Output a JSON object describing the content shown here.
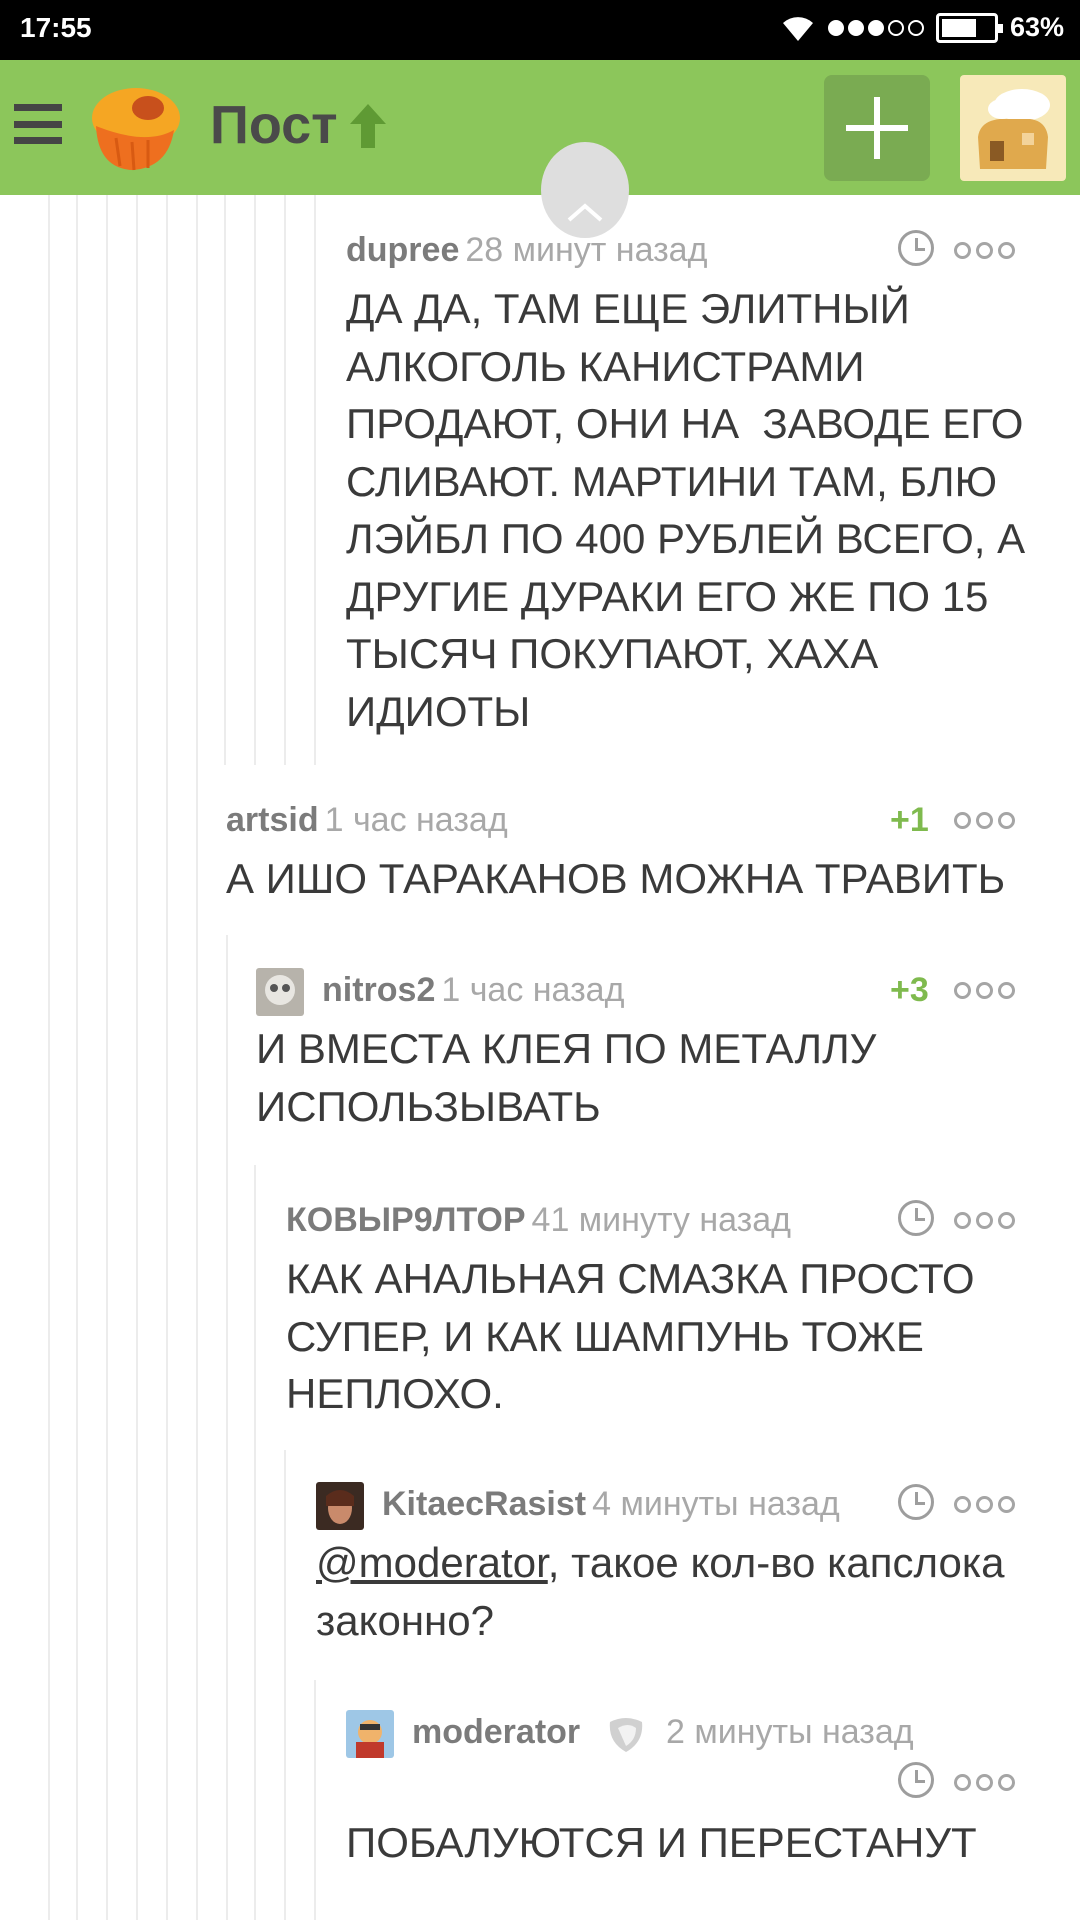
{
  "status": {
    "time": "17:55",
    "battery": "63%"
  },
  "header": {
    "title": "Пост"
  },
  "comments": [
    {
      "author": "dupree",
      "time": "28 минут назад",
      "rating": "",
      "text": [
        "ДА ДА, ТАМ ЕЩЕ ЭЛИТНЫЙ",
        "АЛКОГОЛЬ КАНИСТРАМИ",
        "ПРОДАЮТ, ОНИ НА  ЗАВОДЕ ЕГО",
        "СЛИВАЮТ. МАРТИНИ ТАМ, БЛЮ",
        "ЛЭЙБЛ ПО 400 РУБЛЕЙ ВСЕГО, А",
        "ДРУГИЕ ДУРАКИ ЕГО ЖЕ ПО 15",
        "ТЫСЯЧ ПОКУПАЮТ, ХАХА",
        "ИДИОТЫ"
      ]
    },
    {
      "author": "artsid",
      "time": "1 час назад",
      "rating": "+1",
      "text": [
        "А ИШО ТАРАКАНОВ МОЖНА ТРАВИТЬ"
      ]
    },
    {
      "author": "nitros2",
      "time": "1 час назад",
      "rating": "+3",
      "text": [
        "И ВМЕСТА КЛЕЯ ПО МЕТАЛЛУ",
        "ИСПОЛЬЗЫВАТЬ"
      ]
    },
    {
      "author": "КОВЫР9ЛТОР",
      "time": "41 минуту назад",
      "rating": "",
      "text": [
        "КАК АНАЛЬНАЯ СМАЗКА ПРОСТО",
        "СУПЕР, И КАК ШАМПУНЬ ТОЖЕ",
        "НЕПЛОХО."
      ]
    },
    {
      "author": "KitaecRasist",
      "time": "4 минуты назад",
      "rating": "",
      "mention": "@moderator",
      "text_after_mention": ", такое кол-во капслока",
      "text2": "законно?"
    },
    {
      "author": "moderator",
      "time": "2 минуты назад",
      "rating": "",
      "text": [
        "ПОБАЛУЮТСЯ И ПЕРЕСТАНУТ"
      ]
    }
  ],
  "icons": {
    "menu": "menu-icon",
    "logo": "cupcake-logo-icon",
    "arrow": "arrow-up-icon",
    "add": "plus-icon",
    "clock": "clock-icon",
    "more": "more-dots-icon",
    "moderator_badge": "moderator-badge-icon"
  },
  "colors": {
    "accent": "#8cc65b",
    "rating": "#7fba4e"
  }
}
